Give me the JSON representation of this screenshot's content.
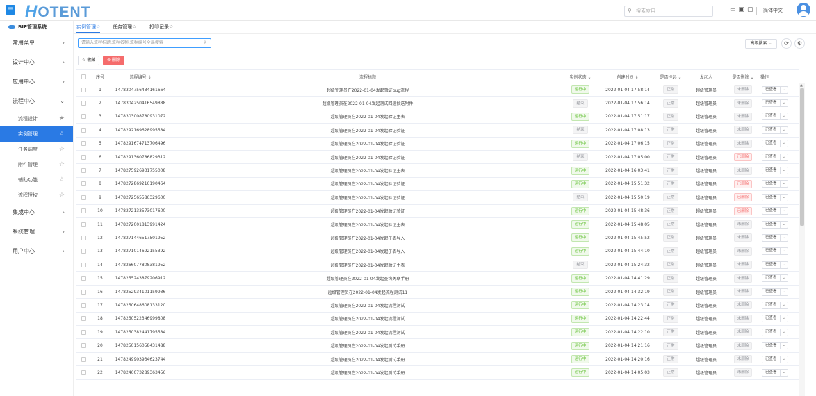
{
  "topbar": {
    "logo_h": "H",
    "logo_rest": "OTENT",
    "search_placeholder": "搜索应用",
    "lang": "简体中文"
  },
  "sidebar": {
    "header": "BIP管理系统",
    "items": [
      {
        "label": "常用菜单",
        "arrow": "›"
      },
      {
        "label": "设计中心",
        "arrow": "›"
      },
      {
        "label": "应用中心",
        "arrow": "›"
      },
      {
        "label": "流程中心",
        "arrow": "⌄"
      }
    ],
    "subitems": [
      {
        "label": "流程设计",
        "star": "★"
      },
      {
        "label": "实例管理",
        "star": "☆",
        "active": true
      },
      {
        "label": "任务调度",
        "star": "☆"
      },
      {
        "label": "附件管理",
        "star": "☆"
      },
      {
        "label": "辅助功能",
        "star": "☆"
      },
      {
        "label": "流程授权",
        "star": "☆"
      }
    ],
    "items_after": [
      {
        "label": "集成中心",
        "arrow": "›"
      },
      {
        "label": "系统管理",
        "arrow": "›"
      },
      {
        "label": "用户中心",
        "arrow": "›"
      }
    ]
  },
  "tabs": [
    {
      "label": "实例管理☆",
      "active": true
    },
    {
      "label": "任务管理☆"
    },
    {
      "label": "打印记录☆"
    }
  ],
  "toolbar": {
    "search_placeholder": "请输入流程标题,流程名称,流程编号全局搜索",
    "adv_search": "高级搜索 ⌄",
    "collect": "☆ 收藏",
    "delete": "⊗ 删除"
  },
  "table": {
    "headers": [
      "序号",
      "流程编号 ⇕",
      "流程标题",
      "实例状态 ⌄",
      "创建时间 ⇕",
      "是否挂起 ⌄",
      "发起人",
      "是否删除 ⌄",
      "操作"
    ],
    "rows": [
      {
        "no": "1",
        "code": "1478304756434161664",
        "title": "超级管理员在2022-01-04发起验证bug流程",
        "status": "运行中",
        "time": "2022-01-04 17:58:14",
        "hang": "正常",
        "user": "超级管理员",
        "del": "未删除",
        "op": "已查看"
      },
      {
        "no": "2",
        "code": "1478304250416549888",
        "title": "超级管理员在2022-01-04发起测试回退抄送附件",
        "status": "结束",
        "time": "2022-01-04 17:56:14",
        "hang": "正常",
        "user": "超级管理员",
        "del": "未删除",
        "op": "已查看"
      },
      {
        "no": "3",
        "code": "1478303008780931072",
        "title": "超级管理员在2022-01-04发起验证主表",
        "status": "运行中",
        "time": "2022-01-04 17:51:17",
        "hang": "正常",
        "user": "超级管理员",
        "del": "未删除",
        "op": "已查看"
      },
      {
        "no": "4",
        "code": "1478292169628995584",
        "title": "超级管理员在2022-01-04发起验证验证",
        "status": "结束",
        "time": "2022-01-04 17:08:13",
        "hang": "正常",
        "user": "超级管理员",
        "del": "未删除",
        "op": "已查看"
      },
      {
        "no": "5",
        "code": "1478291674713706496",
        "title": "超级管理员在2022-01-04发起验证验证",
        "status": "运行中",
        "time": "2022-01-04 17:06:15",
        "hang": "正常",
        "user": "超级管理员",
        "del": "未删除",
        "op": "已查看"
      },
      {
        "no": "6",
        "code": "1478291360786829312",
        "title": "超级管理员在2022-01-04发起验证验证",
        "status": "结束",
        "time": "2022-01-04 17:05:00",
        "hang": "正常",
        "user": "超级管理员",
        "del": "已删除",
        "op": "已查看"
      },
      {
        "no": "7",
        "code": "1478275926931755008",
        "title": "超级管理员在2022-01-04发起验证主表",
        "status": "运行中",
        "time": "2022-01-04 16:03:41",
        "hang": "正常",
        "user": "超级管理员",
        "del": "未删除",
        "op": "已查看"
      },
      {
        "no": "8",
        "code": "1478272869216190464",
        "title": "超级管理员在2022-01-04发起验证验证",
        "status": "运行中",
        "time": "2022-01-04 15:51:32",
        "hang": "正常",
        "user": "超级管理员",
        "del": "已删除",
        "op": "已查看"
      },
      {
        "no": "9",
        "code": "1478272565586329600",
        "title": "超级管理员在2022-01-04发起验证验证",
        "status": "结束",
        "time": "2022-01-04 15:50:19",
        "hang": "正常",
        "user": "超级管理员",
        "del": "已删除",
        "op": "已查看"
      },
      {
        "no": "10",
        "code": "1478272133573017600",
        "title": "超级管理员在2022-01-04发起验证验证",
        "status": "运行中",
        "time": "2022-01-04 15:48:36",
        "hang": "正常",
        "user": "超级管理员",
        "del": "已删除",
        "op": "已查看"
      },
      {
        "no": "11",
        "code": "1478272001813991424",
        "title": "超级管理员在2022-01-04发起验证主表",
        "status": "运行中",
        "time": "2022-01-04 15:48:05",
        "hang": "正常",
        "user": "超级管理员",
        "del": "未删除",
        "op": "已查看"
      },
      {
        "no": "12",
        "code": "1478271446517501952",
        "title": "超级管理员在2022-01-04发起子表导入",
        "status": "运行中",
        "time": "2022-01-04 15:45:52",
        "hang": "正常",
        "user": "超级管理员",
        "del": "未删除",
        "op": "已查看"
      },
      {
        "no": "13",
        "code": "1478271014692155392",
        "title": "超级管理员在2022-01-04发起子表导入",
        "status": "运行中",
        "time": "2022-01-04 15:44:10",
        "hang": "正常",
        "user": "超级管理员",
        "del": "未删除",
        "op": "已查看"
      },
      {
        "no": "14",
        "code": "1478266077808381952",
        "title": "超级管理员在2022-01-04发起验证主表",
        "status": "结束",
        "time": "2022-01-04 15:24:32",
        "hang": "正常",
        "user": "超级管理员",
        "del": "未删除",
        "op": "已查看"
      },
      {
        "no": "15",
        "code": "1478255243879206912",
        "title": "超级管理员在2022-01-04发起查询关联手册",
        "status": "运行中",
        "time": "2022-01-04 14:41:29",
        "hang": "正常",
        "user": "超级管理员",
        "del": "未删除",
        "op": "已查看"
      },
      {
        "no": "16",
        "code": "1478252934101159936",
        "title": "超级管理员在2022-01-04发起流程测试11",
        "status": "运行中",
        "time": "2022-01-04 14:32:19",
        "hang": "正常",
        "user": "超级管理员",
        "del": "未删除",
        "op": "已查看"
      },
      {
        "no": "17",
        "code": "1478250648608133120",
        "title": "超级管理员在2022-01-04发起流程测试",
        "status": "运行中",
        "time": "2022-01-04 14:23:14",
        "hang": "正常",
        "user": "超级管理员",
        "del": "未删除",
        "op": "已查看"
      },
      {
        "no": "18",
        "code": "1478250522346999808",
        "title": "超级管理员在2022-01-04发起流程测试",
        "status": "运行中",
        "time": "2022-01-04 14:22:44",
        "hang": "正常",
        "user": "超级管理员",
        "del": "未删除",
        "op": "已查看"
      },
      {
        "no": "19",
        "code": "1478250382441795584",
        "title": "超级管理员在2022-01-04发起流程测试",
        "status": "运行中",
        "time": "2022-01-04 14:22:10",
        "hang": "正常",
        "user": "超级管理员",
        "del": "未删除",
        "op": "已查看"
      },
      {
        "no": "20",
        "code": "1478250156058431488",
        "title": "超级管理员在2022-01-04发起测试手册",
        "status": "运行中",
        "time": "2022-01-04 14:21:16",
        "hang": "正常",
        "user": "超级管理员",
        "del": "未删除",
        "op": "已查看"
      },
      {
        "no": "21",
        "code": "1478249903934623744",
        "title": "超级管理员在2022-01-04发起测试手册",
        "status": "运行中",
        "time": "2022-01-04 14:20:16",
        "hang": "正常",
        "user": "超级管理员",
        "del": "未删除",
        "op": "已查看"
      },
      {
        "no": "22",
        "code": "1478246073289363456",
        "title": "超级管理员在2022-01-04发起测试手册",
        "status": "运行中",
        "time": "2022-01-04 14:05:03",
        "hang": "正常",
        "user": "超级管理员",
        "del": "未删除",
        "op": "已查看"
      }
    ]
  },
  "colors": {
    "accent": "#2a7ae4",
    "running": "#67c23a",
    "deleted": "#f56c6c"
  }
}
